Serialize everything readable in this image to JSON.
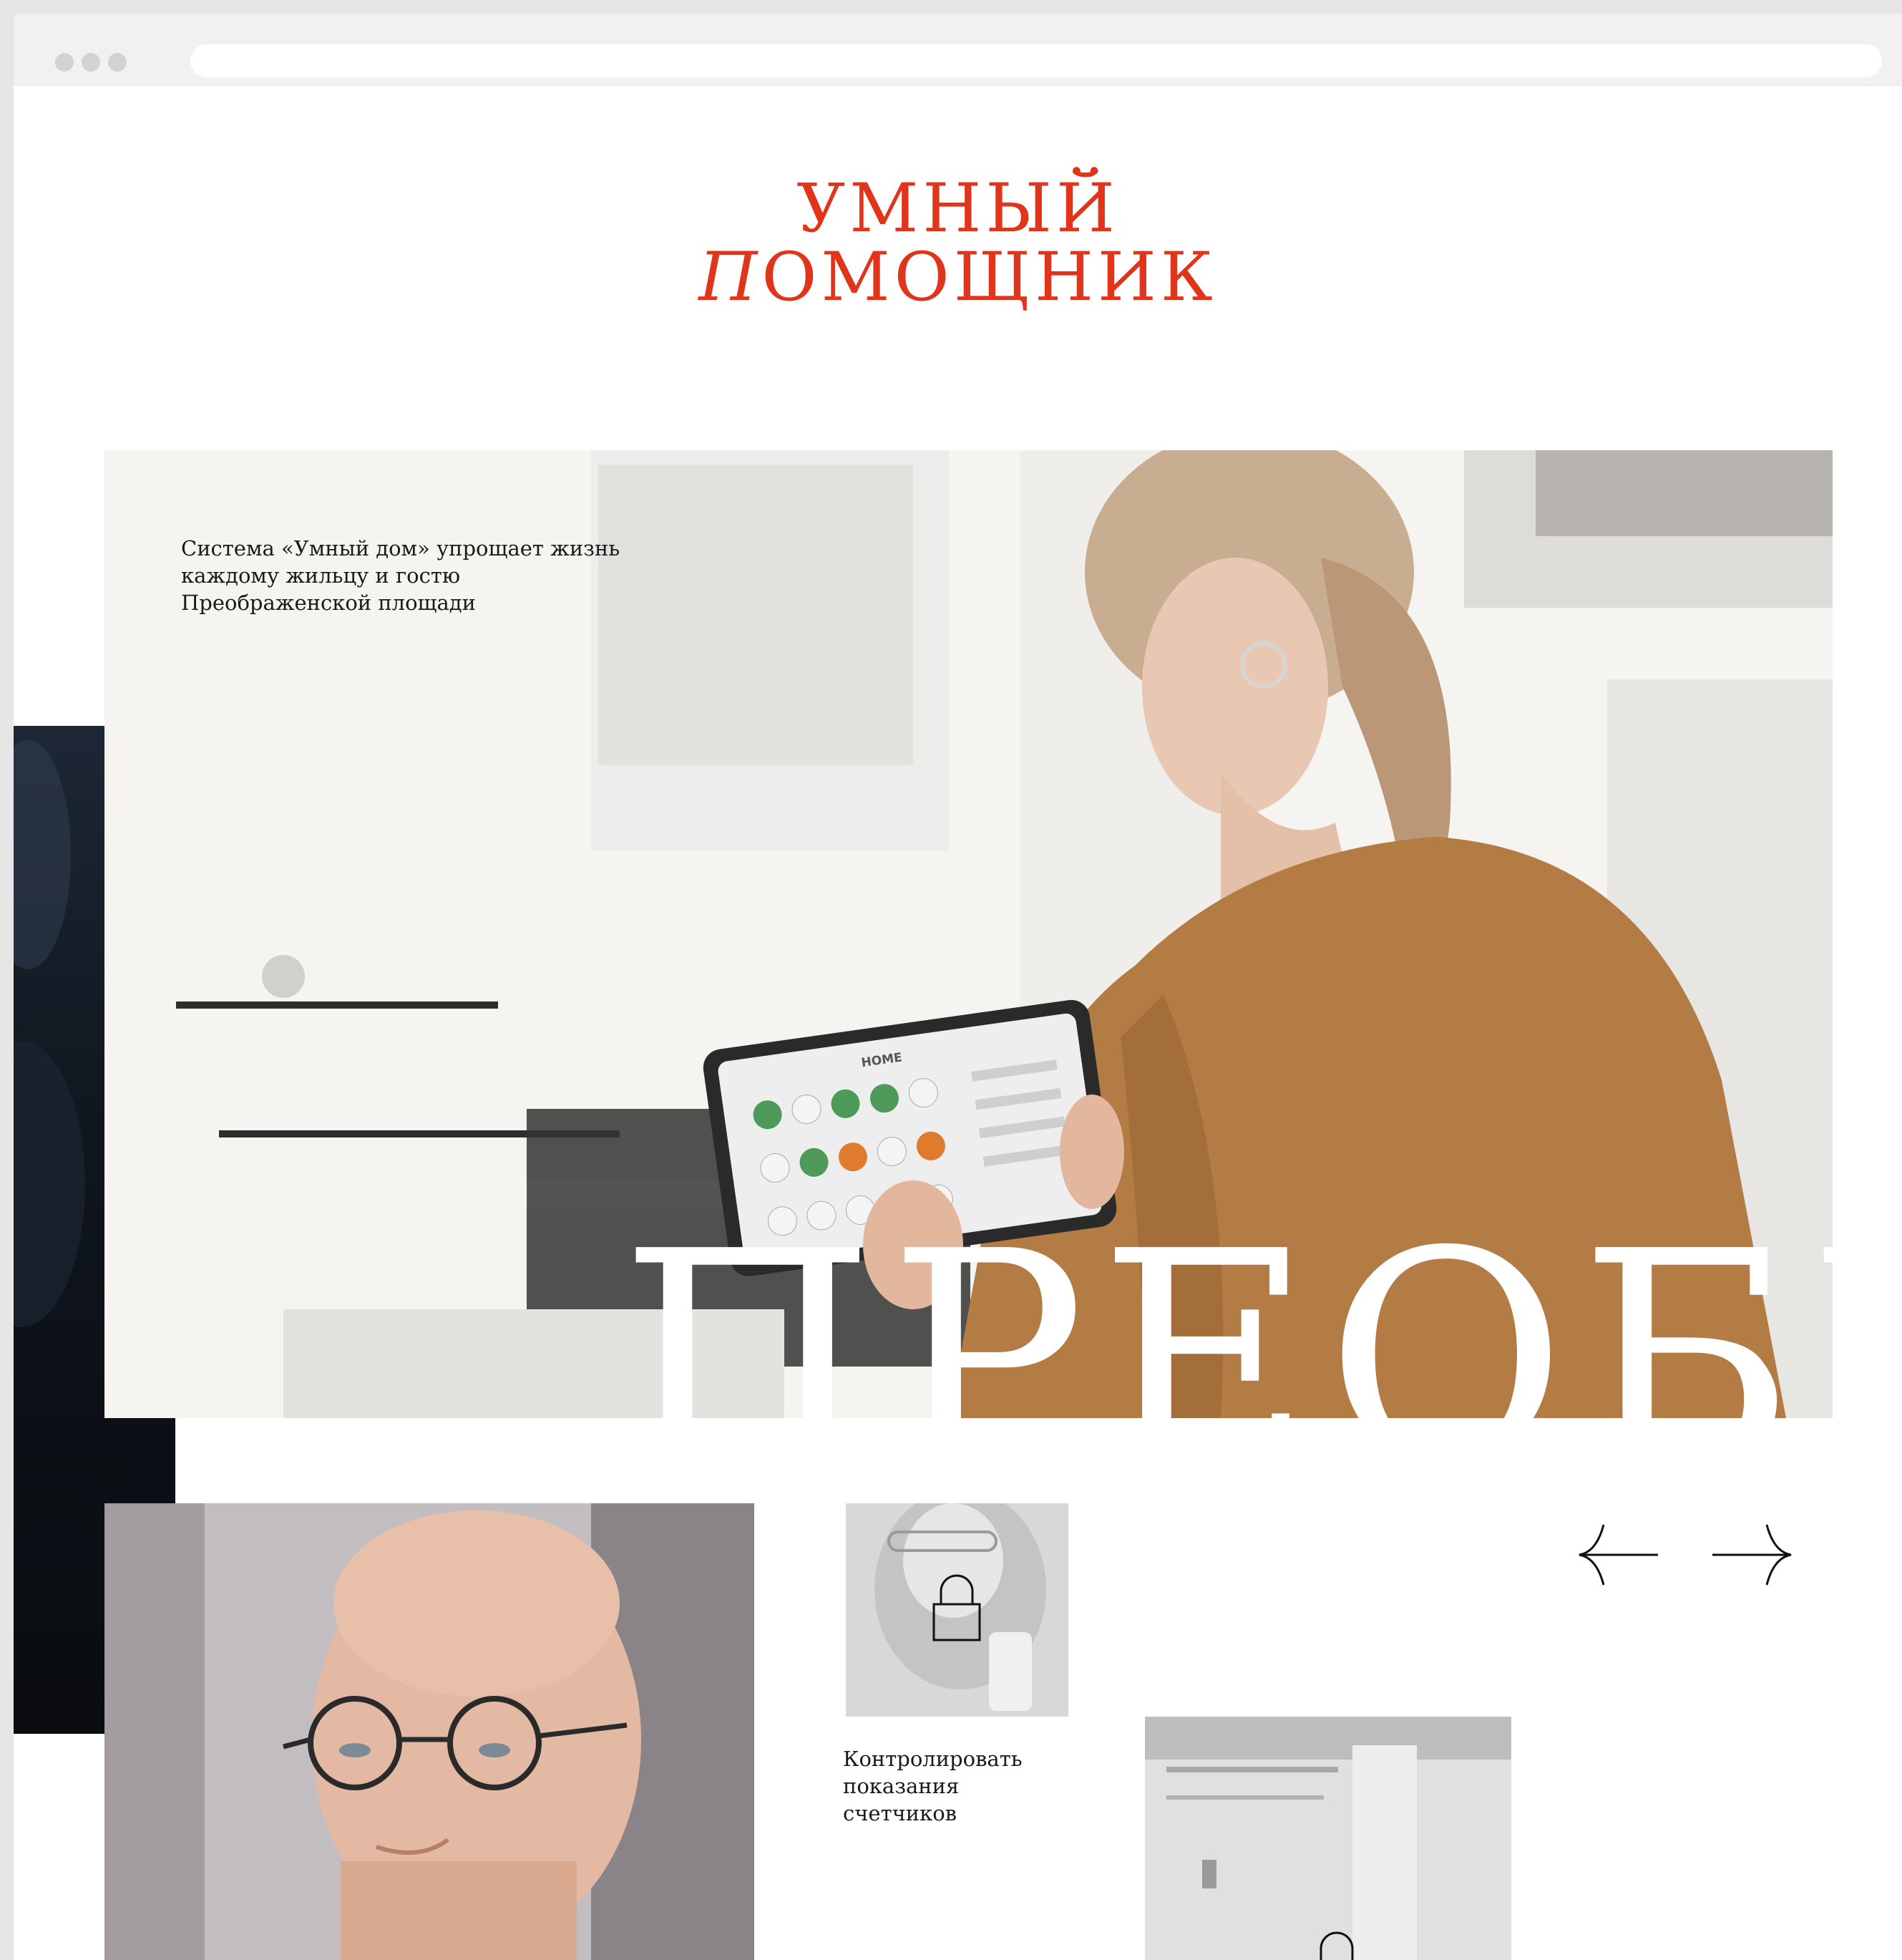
{
  "header": {
    "title_line1": "УМНЫЙ",
    "title_line2_first": "П",
    "title_line2_rest": "ОМОЩНИК"
  },
  "hero": {
    "text_lines": [
      "Система «Умный дом» упрощает жизнь",
      "каждому жильцу и гостю",
      "Преображенской площади"
    ],
    "big_word": "ПРЕОБР",
    "tablet_title": "HOME"
  },
  "features": {
    "card1_caption": [
      "Контролировать",
      "показания",
      "счетчиков"
    ]
  },
  "icons": {
    "lock": "lock-icon",
    "prev": "arrow-left-icon",
    "next": "arrow-right-icon"
  },
  "colors": {
    "accent": "#e0341b",
    "jacket": "#b47c45",
    "tablet_green": "#4e9a5b",
    "tablet_orange": "#e07a2c"
  }
}
